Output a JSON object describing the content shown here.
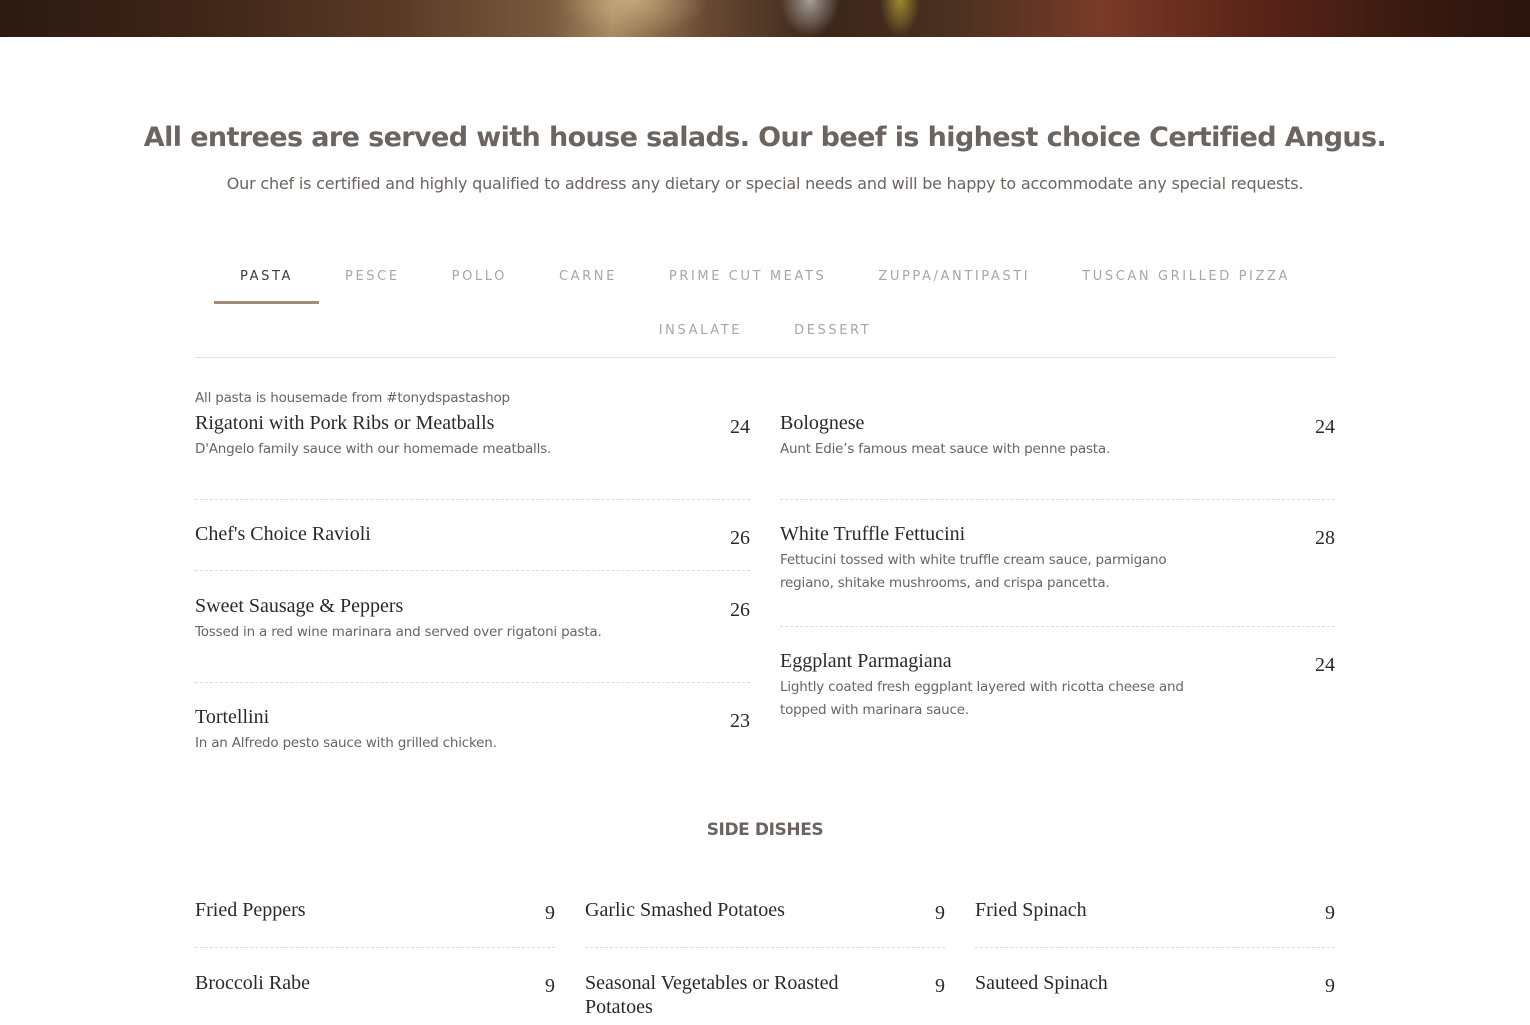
{
  "headline": "All entrees are served with house salads. Our beef is highest choice Certified Angus.",
  "subline": "Our chef is certified and highly qualified to address any dietary or special needs and will be happy to accommodate any special requests.",
  "tabs": {
    "row1": [
      "PASTA",
      "PESCE",
      "POLLO",
      "CARNE",
      "PRIME CUT MEATS",
      "ZUPPA/ANTIPASTI",
      "TUSCAN GRILLED PIZZA"
    ],
    "row2": [
      "INSALATE",
      "DESSERT"
    ],
    "active": "PASTA"
  },
  "pasta": {
    "note": "All pasta is housemade from #tonydspastashop",
    "left": [
      {
        "name": "Rigatoni with Pork Ribs or Meatballs",
        "price": "24",
        "desc": "D'Angelo family sauce with our homemade meatballs."
      },
      {
        "name": "Chef's Choice Ravioli",
        "price": "26",
        "desc": ""
      },
      {
        "name": "Sweet Sausage & Peppers",
        "price": "26",
        "desc": "Tossed in a red wine marinara and served over rigatoni pasta."
      },
      {
        "name": "Tortellini",
        "price": "23",
        "desc": "In an Alfredo pesto sauce with grilled chicken."
      }
    ],
    "right": [
      {
        "name": "Bolognese",
        "price": "24",
        "desc": "Aunt Edie’s famous meat sauce with penne pasta."
      },
      {
        "name": "White Truffle Fettucini",
        "price": "28",
        "desc": "Fettucini tossed with white truffle cream sauce, parmigano regiano, shitake mushrooms, and crispa pancetta."
      },
      {
        "name": "Eggplant Parmagiana",
        "price": "24",
        "desc": "Lightly coated fresh eggplant layered with ricotta cheese and topped with marinara sauce."
      }
    ]
  },
  "side_dishes": {
    "title": "SIDE DISHES",
    "col1": [
      {
        "name": "Fried Peppers",
        "price": "9"
      },
      {
        "name": "Broccoli Rabe",
        "price": "9"
      }
    ],
    "col2": [
      {
        "name": "Garlic Smashed Potatoes",
        "price": "9"
      },
      {
        "name": "Seasonal Vegetables or Roasted Potatoes",
        "price": "9"
      }
    ],
    "col3": [
      {
        "name": "Fried Spinach",
        "price": "9"
      },
      {
        "name": "Sauteed Spinach",
        "price": "9"
      }
    ]
  },
  "colors": {
    "accent_underline": "#a38d7a",
    "heading": "#6b6460",
    "item_text": "#2a2a2a",
    "tab_inactive": "#a8a6a6"
  }
}
